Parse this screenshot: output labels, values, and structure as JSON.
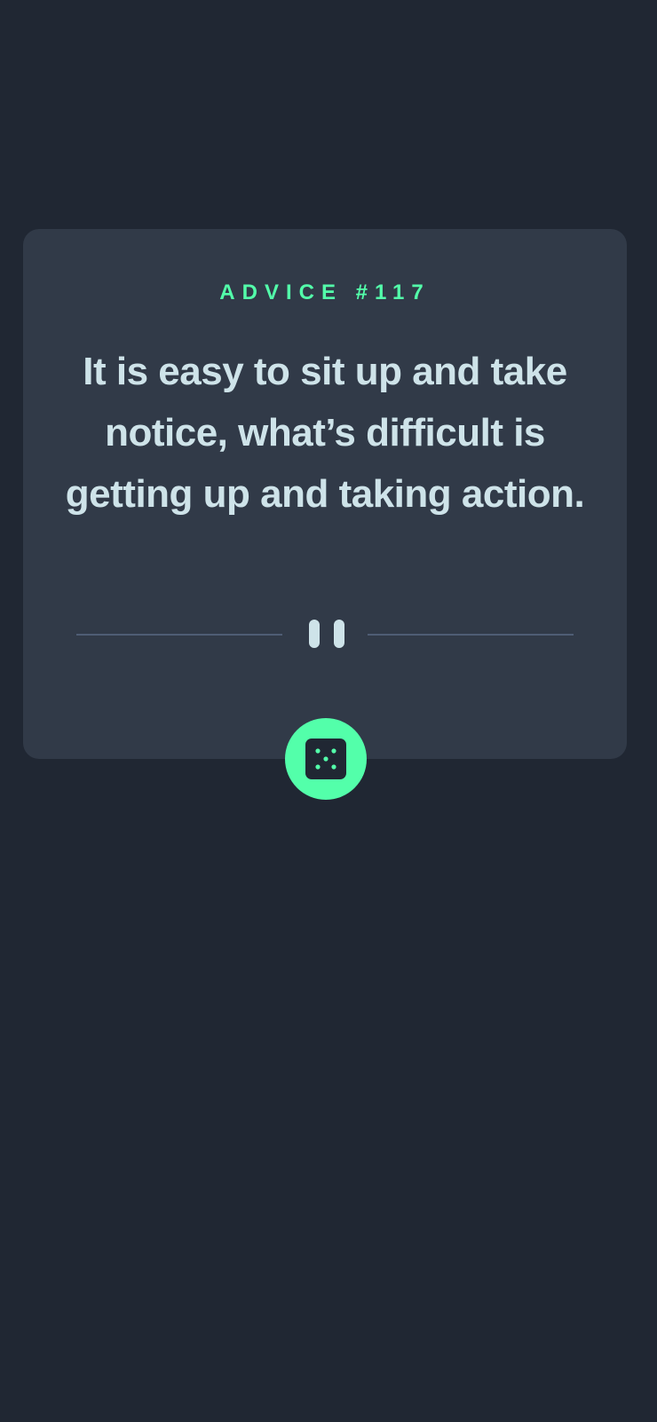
{
  "advice": {
    "id_label": "ADVICE #117",
    "quote": "It is easy to sit up and take notice, what’s difficult is getting up and taking action."
  },
  "icons": {
    "divider": "pause-icon",
    "button": "dice-icon"
  },
  "colors": {
    "background": "#202733",
    "card": "#313a48",
    "accent": "#53ffaa",
    "text": "#cee3e9",
    "divider_line": "#4f5d74"
  }
}
